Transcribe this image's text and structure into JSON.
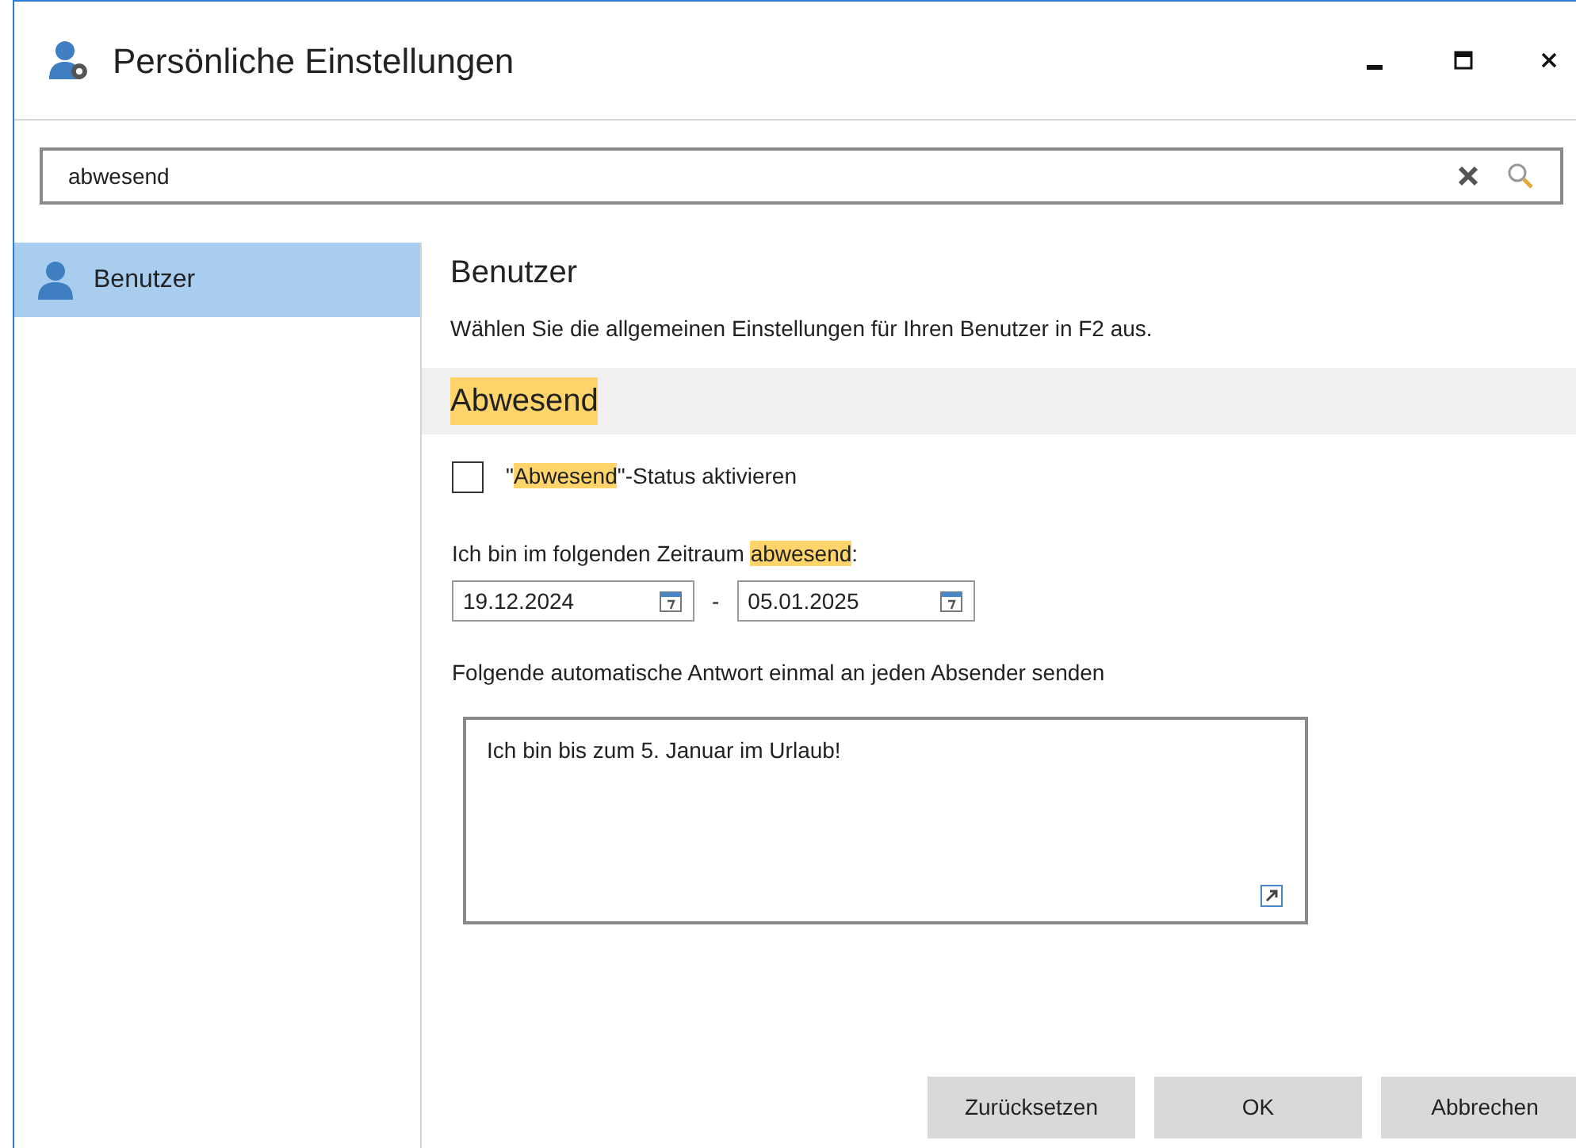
{
  "window": {
    "title": "Persönliche Einstellungen"
  },
  "search": {
    "value": "abwesend"
  },
  "sidebar": {
    "items": [
      {
        "label": "Benutzer",
        "selected": true
      }
    ]
  },
  "panel": {
    "title": "Benutzer",
    "description": "Wählen Sie die allgemeinen Einstellungen für Ihren Benutzer in F2 aus.",
    "section": {
      "title": "Abwesend",
      "highlighted": true
    },
    "checkbox": {
      "checked": false,
      "label": [
        {
          "text": "\"",
          "highlighted": false
        },
        {
          "text": "Abwesend",
          "highlighted": true
        },
        {
          "text": "\"-Status aktivieren",
          "highlighted": false
        }
      ]
    },
    "period_label": [
      {
        "text": "Ich bin im folgenden Zeitraum ",
        "highlighted": false
      },
      {
        "text": "abwesend",
        "highlighted": true
      },
      {
        "text": ":",
        "highlighted": false
      }
    ],
    "date_from": "19.12.2024",
    "separator": "-",
    "date_to": "05.01.2025",
    "reply_label": "Folgende automatische Antwort einmal an jeden Absender senden",
    "reply_text": "Ich bin bis zum 5. Januar im Urlaub!"
  },
  "buttons": [
    "Zurücksetzen",
    "OK",
    "Abbrechen"
  ]
}
